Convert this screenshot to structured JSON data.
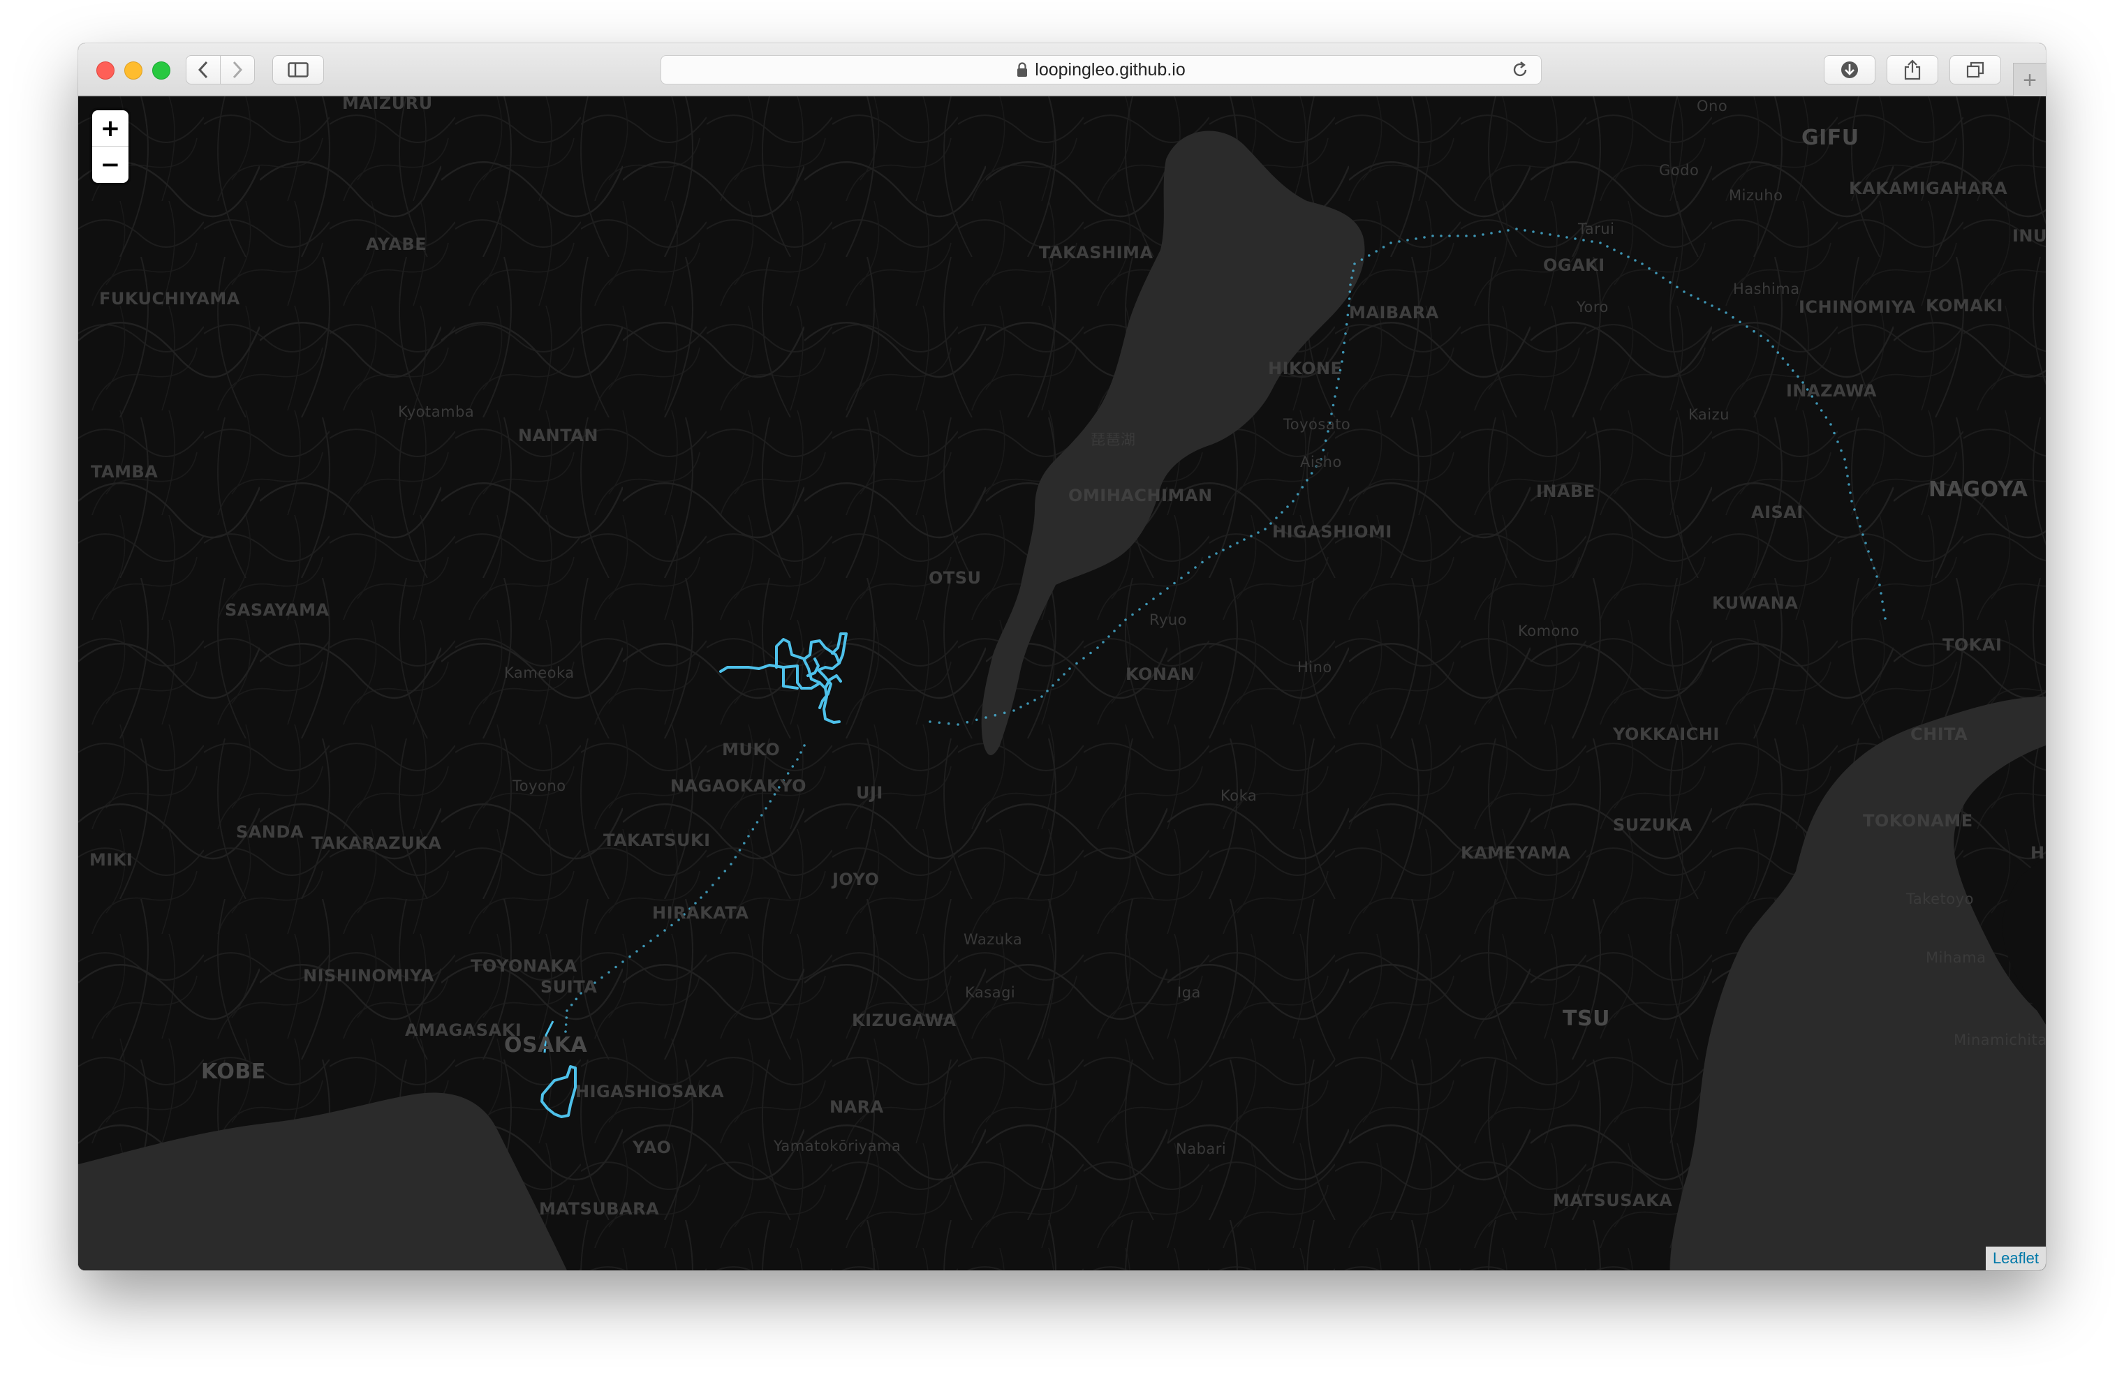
{
  "browser": {
    "url": "loopingleo.github.io",
    "icons": [
      "back-icon",
      "forward-icon",
      "sidebar-icon",
      "lock-icon",
      "reload-icon",
      "download-icon",
      "share-icon",
      "tabs-icon",
      "new-tab-icon"
    ]
  },
  "map": {
    "zoom_in": "+",
    "zoom_out": "−",
    "attribution": "Leaflet",
    "track_color": "#4ec1ea",
    "labels": [
      {
        "text": "MAIZURU",
        "kind": "city"
      },
      {
        "text": "AYABE",
        "kind": "city"
      },
      {
        "text": "FUKUCHIYAMA",
        "kind": "city"
      },
      {
        "text": "TAKASHIMA",
        "kind": "city"
      },
      {
        "text": "Kyotamba",
        "kind": "town"
      },
      {
        "text": "NANTAN",
        "kind": "city"
      },
      {
        "text": "TAMBA",
        "kind": "city"
      },
      {
        "text": "MAIBARA",
        "kind": "city"
      },
      {
        "text": "HIKONE",
        "kind": "city"
      },
      {
        "text": "Toyosato",
        "kind": "town"
      },
      {
        "text": "Aisho",
        "kind": "town"
      },
      {
        "text": "OMIHACHIMAN",
        "kind": "city"
      },
      {
        "text": "HIGASHIOMI",
        "kind": "city"
      },
      {
        "text": "OTSU",
        "kind": "city"
      },
      {
        "text": "SASAYAMA",
        "kind": "city"
      },
      {
        "text": "Ryuo",
        "kind": "town"
      },
      {
        "text": "Kameoka",
        "kind": "town"
      },
      {
        "text": "KONAN",
        "kind": "city"
      },
      {
        "text": "Hino",
        "kind": "town"
      },
      {
        "text": "MUKO",
        "kind": "city"
      },
      {
        "text": "Toyono",
        "kind": "town"
      },
      {
        "text": "NAGAOKAKYO",
        "kind": "city"
      },
      {
        "text": "UJI",
        "kind": "city"
      },
      {
        "text": "SANDA",
        "kind": "city"
      },
      {
        "text": "TAKARAZUKA",
        "kind": "city"
      },
      {
        "text": "TAKATSUKI",
        "kind": "city"
      },
      {
        "text": "Koka",
        "kind": "town"
      },
      {
        "text": "MIKI",
        "kind": "city"
      },
      {
        "text": "JOYO",
        "kind": "city"
      },
      {
        "text": "HIRAKATA",
        "kind": "city"
      },
      {
        "text": "Wazuka",
        "kind": "town"
      },
      {
        "text": "TOYONAKA",
        "kind": "city"
      },
      {
        "text": "NISHINOMIYA",
        "kind": "city"
      },
      {
        "text": "SUITA",
        "kind": "city"
      },
      {
        "text": "Kasagi",
        "kind": "town"
      },
      {
        "text": "Iga",
        "kind": "town"
      },
      {
        "text": "KIZUGAWA",
        "kind": "city"
      },
      {
        "text": "AMAGASAKI",
        "kind": "city"
      },
      {
        "text": "OSAKA",
        "kind": "big"
      },
      {
        "text": "KOBE",
        "kind": "big"
      },
      {
        "text": "HIGASHIOSAKA",
        "kind": "city"
      },
      {
        "text": "NARA",
        "kind": "city"
      },
      {
        "text": "YAO",
        "kind": "city"
      },
      {
        "text": "Yamatokōriyama",
        "kind": "town"
      },
      {
        "text": "Nabari",
        "kind": "town"
      },
      {
        "text": "MATSUBARA",
        "kind": "city"
      },
      {
        "text": "Ono",
        "kind": "town"
      },
      {
        "text": "GIFU",
        "kind": "big"
      },
      {
        "text": "Godo",
        "kind": "town"
      },
      {
        "text": "Mizuho",
        "kind": "town"
      },
      {
        "text": "KAKAMIGAHARA",
        "kind": "city"
      },
      {
        "text": "Tarui",
        "kind": "town"
      },
      {
        "text": "OGAKI",
        "kind": "city"
      },
      {
        "text": "Hashima",
        "kind": "town"
      },
      {
        "text": "Yoro",
        "kind": "town"
      },
      {
        "text": "ICHINOMIYA",
        "kind": "city"
      },
      {
        "text": "KOMAKI",
        "kind": "city"
      },
      {
        "text": "INU",
        "kind": "city"
      },
      {
        "text": "INAZAWA",
        "kind": "city"
      },
      {
        "text": "Kaizu",
        "kind": "town"
      },
      {
        "text": "INABE",
        "kind": "city"
      },
      {
        "text": "AISAI",
        "kind": "city"
      },
      {
        "text": "NAGOYA",
        "kind": "big"
      },
      {
        "text": "KUWANA",
        "kind": "city"
      },
      {
        "text": "Komono",
        "kind": "town"
      },
      {
        "text": "TOKAI",
        "kind": "city"
      },
      {
        "text": "YOKKAICHI",
        "kind": "city"
      },
      {
        "text": "CHITA",
        "kind": "city"
      },
      {
        "text": "SUZUKA",
        "kind": "city"
      },
      {
        "text": "KAMEYAMA",
        "kind": "city"
      },
      {
        "text": "TOKONAME",
        "kind": "city"
      },
      {
        "text": "HE",
        "kind": "city"
      },
      {
        "text": "Taketoyo",
        "kind": "town"
      },
      {
        "text": "Mihama",
        "kind": "town"
      },
      {
        "text": "TSU",
        "kind": "big"
      },
      {
        "text": "Minamichita",
        "kind": "town"
      },
      {
        "text": "MATSUSAKA",
        "kind": "city"
      },
      {
        "text": "琵琶湖",
        "kind": "town"
      }
    ]
  }
}
